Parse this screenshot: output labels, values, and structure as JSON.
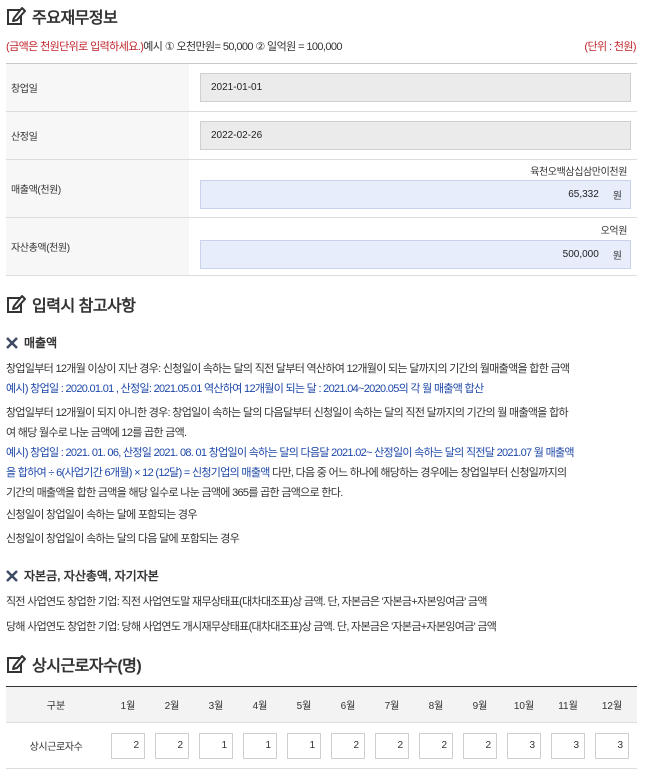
{
  "section1": {
    "title": "주요재무정보"
  },
  "notice": {
    "red": "(금액은 천원단위로 입력하세요.)",
    "example": "예시 ① 오천만원= 50,000 ② 일억원 = 100,000",
    "unit": "(단위 : 천원)"
  },
  "form": {
    "founding": {
      "label": "창업일",
      "value": "2021-01-01"
    },
    "apply": {
      "label": "산정일",
      "value": "2022-02-26"
    },
    "sales": {
      "label": "매출액(천원)",
      "hint": "육천오백삼십삼만이천원",
      "value": "65,332",
      "suffix": "원"
    },
    "assets": {
      "label": "자산총액(천원)",
      "hint": "오억원",
      "value": "500,000",
      "suffix": "원"
    }
  },
  "section2": {
    "title": "입력시 참고사항"
  },
  "sales_ref": {
    "title": "매출액",
    "p1": "창업일부터 12개월 이상이 지난 경우: 신청일이 속하는 달의 직전 달부터 역산하여 12개월이 되는 달까지의 기간의 월매출액을 합한 금액",
    "p2": "예시) 창업일 : 2020.01.01 , 산정일: 2021.05.01 역산하여 12개월이 되는 달 : 2021.04~2020.05의 각 월 매출액 합산",
    "p3a": "창업일부터 12개월이 되지 아니한 경우: 창업일이 속하는 달의 다음달부터 신청일이 속하는 달의 직전 달까지의 기간의 월 매출액을 합하",
    "p3b": "여 해당 월수로 나눈 금액에 12를 곱한 금액.",
    "p4a": "예시) 창업일 : 2021. 01. 06, 산정일 2021. 08. 01 창업일이 속하는 달의 다음달 2021.02~ 산정일이 속하는 달의 직전달 2021.07 월 매출액",
    "p4b_blue": "을 합하여 ÷ 6(사업기간 6개월) × 12 (12달) = 신청기업의 매출액",
    "p4b_rest": " 다만, 다음 중 어느 하나에 해당하는 경우에는 창업일부터 신청일까지의",
    "p4c": "기간의 매출액을 합한 금액을 해당 일수로 나눈 금액에 365를 곱한 금액으로 한다.",
    "p5": "신청일이 창업일이 속하는 달에 포함되는 경우",
    "p6": "신청일이 창업일이 속하는 달의 다음 달에 포함되는 경우"
  },
  "capital_ref": {
    "title": "자본금, 자산총액, 자기자본",
    "p1": "직전 사업연도 창업한 기업: 직전 사업연도말 재무상태표(대차대조표)상 금액. 단, 자본금은 '자본금+자본잉여금' 금액",
    "p2": "당해 사업연도 창업한 기업: 당해 사업연도 개시재무상태표(대차대조표)상 금액. 단, 자본금은 '자본금+자본잉여금' 금액"
  },
  "section3": {
    "title": "상시근로자수(명)"
  },
  "workers": {
    "header": "구분",
    "months": [
      "1월",
      "2월",
      "3월",
      "4월",
      "5월",
      "6월",
      "7월",
      "8월",
      "9월",
      "10월",
      "11월",
      "12월"
    ],
    "row_label": "상시근로자수",
    "values": [
      "2",
      "2",
      "1",
      "1",
      "1",
      "2",
      "2",
      "2",
      "2",
      "3",
      "3",
      "3"
    ]
  }
}
